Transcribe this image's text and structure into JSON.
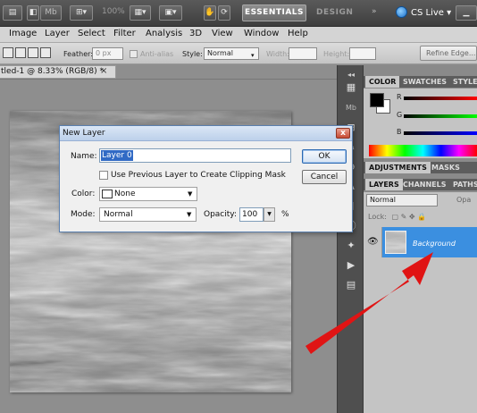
{
  "app_bar": {
    "mb_label": "Mb",
    "zoom": "100%",
    "workspace_active": "ESSENTIALS",
    "workspace_other": "DESIGN",
    "cs_live": "CS Live",
    "cs_live_caret": "▾"
  },
  "menu": [
    "Image",
    "Layer",
    "Select",
    "Filter",
    "Analysis",
    "3D",
    "View",
    "Window",
    "Help"
  ],
  "options_bar": {
    "feather_label": "Feather:",
    "feather_value": "0 px",
    "anti_alias": "Anti-alias",
    "style_label": "Style:",
    "style_value": "Normal",
    "width_label": "Width:",
    "height_label": "Height:",
    "refine_edge": "Refine Edge..."
  },
  "document": {
    "tab_title": "tled-1 @ 8.33% (RGB/8) *",
    "close_glyph": "×"
  },
  "panels": {
    "color_tabs": [
      "COLOR",
      "SWATCHES",
      "STYLES"
    ],
    "color_sliders": [
      "R",
      "G",
      "B"
    ],
    "adjust_tabs": [
      "ADJUSTMENTS",
      "MASKS"
    ],
    "layers_tabs": [
      "LAYERS",
      "CHANNELS",
      "PATHS"
    ],
    "blend_mode": "Normal",
    "opacity_label": "Opa",
    "lock_label": "Lock:",
    "layer_name": "Background",
    "collapse_glyph": "◂◂"
  },
  "dialog": {
    "title": "New Layer",
    "name_label": "Name:",
    "name_value": "Layer 0",
    "clip_label": "Use Previous Layer to Create Clipping Mask",
    "color_label": "Color:",
    "color_value": "None",
    "mode_label": "Mode:",
    "mode_value": "Normal",
    "opacity_label": "Opacity:",
    "opacity_value": "100",
    "percent": "%",
    "ok": "OK",
    "cancel": "Cancel",
    "close_glyph": "x"
  },
  "colors": {
    "selection_blue": "#3b8fe0",
    "annotation_red": "#e01414",
    "dialog_border": "#5a7fae"
  }
}
